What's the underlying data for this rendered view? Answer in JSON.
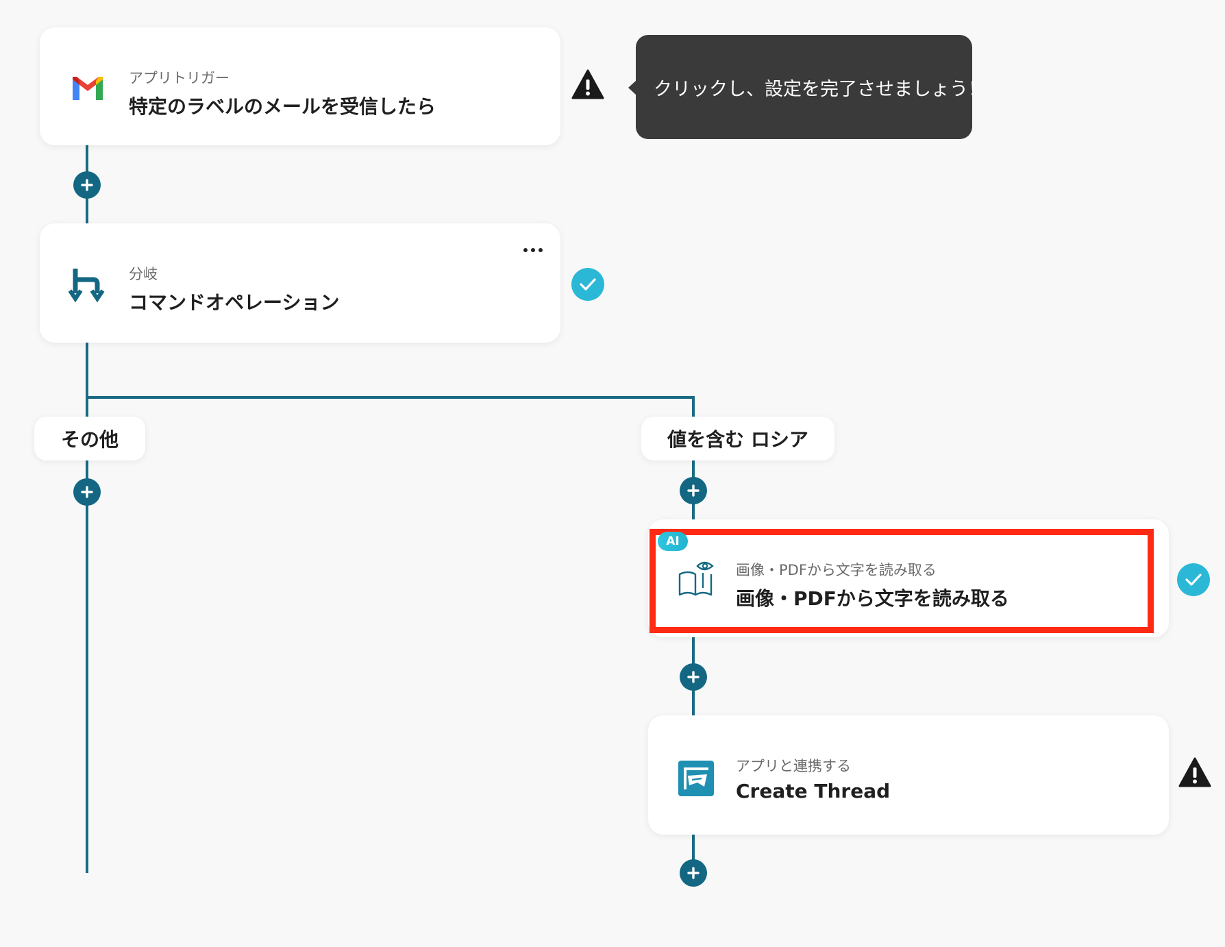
{
  "tooltip": {
    "text": "クリックし、設定を完了させましょう！"
  },
  "steps": [
    {
      "subtitle": "アプリトリガー",
      "title": "特定のラベルのメールを受信したら",
      "icon": "gmail-icon",
      "status": "warning"
    },
    {
      "subtitle": "分岐",
      "title": "コマンドオペレーション",
      "icon": "branch-icon",
      "status": "complete"
    },
    {
      "subtitle": "画像・PDFから文字を読み取る",
      "title": "画像・PDFから文字を読み取る",
      "icon": "ocr-book-icon",
      "status": "complete",
      "badge": "AI"
    },
    {
      "subtitle": "アプリと連携する",
      "title": "Create Thread",
      "icon": "thread-app-icon",
      "status": "warning"
    }
  ],
  "branches": [
    {
      "label": "その他"
    },
    {
      "label": "値を含む ロシア"
    }
  ],
  "colors": {
    "connector": "#1a6a82",
    "plus_button": "#136783",
    "complete": "#2ab8d6",
    "warning": "#1a1a1a",
    "highlight": "#ff2a14"
  }
}
